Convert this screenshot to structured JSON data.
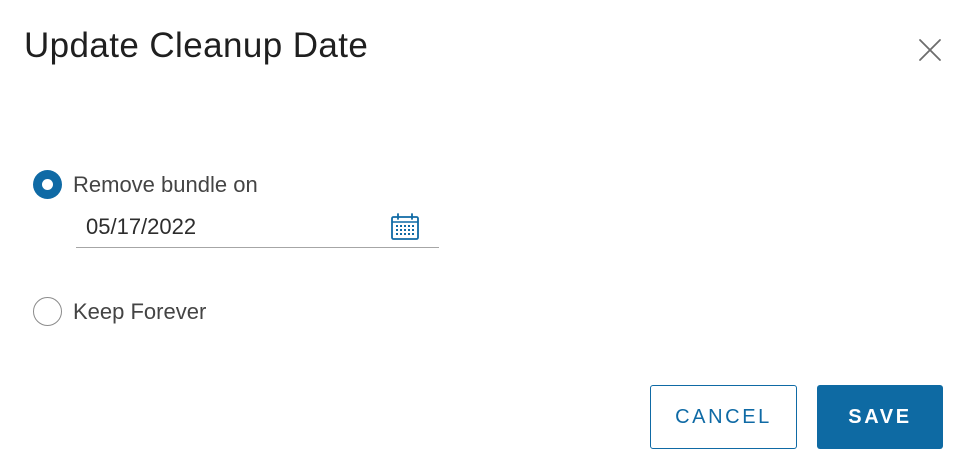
{
  "dialog": {
    "title": "Update Cleanup Date"
  },
  "options": [
    {
      "label": "Remove bundle on",
      "selected": true
    },
    {
      "label": "Keep Forever",
      "selected": false
    }
  ],
  "date_field": {
    "value": "05/17/2022",
    "icon": "calendar-icon"
  },
  "buttons": {
    "cancel_label": "CANCEL",
    "save_label": "SAVE"
  },
  "colors": {
    "accent": "#0f6aa5"
  }
}
